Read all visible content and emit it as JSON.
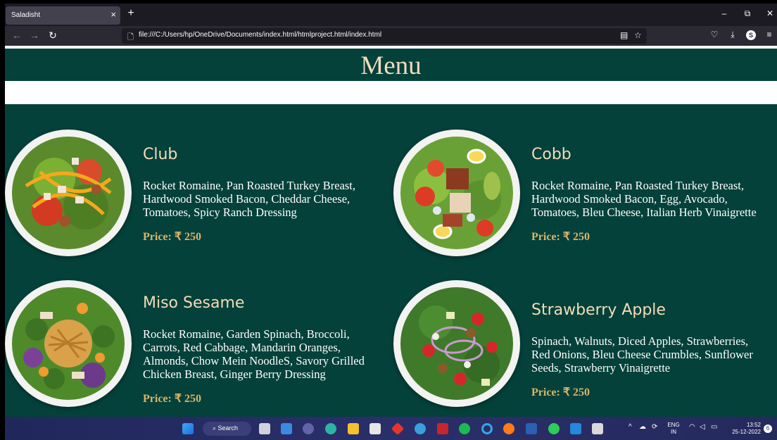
{
  "browser": {
    "tab_title": "Saladisht",
    "tab_close": "×",
    "new_tab": "+",
    "url": "file:///C:/Users/hp/OneDrive/Documents/index.html/htmlproject.html/index.html",
    "window_controls": [
      "–",
      "⧉",
      "✕"
    ],
    "profile_initial": "S"
  },
  "page": {
    "header": "Menu",
    "items": [
      {
        "name": "Club",
        "description": "Rocket Romaine, Pan Roasted Turkey Breast, Hardwood Smoked Bacon, Cheddar Cheese, Tomatoes, Spicy Ranch Dressing",
        "price": "Price: ₹ 250",
        "image": "club-salad-bowl"
      },
      {
        "name": "Cobb",
        "description": "Rocket Romaine, Pan Roasted Turkey Breast, Hardwood Smoked Bacon, Egg, Avocado, Tomatoes, Bleu Cheese, Italian Herb Vinaigrette",
        "price": "Price: ₹ 250",
        "image": "cobb-salad-bowl"
      },
      {
        "name": "Miso Sesame",
        "description": "Rocket Romaine, Garden Spinach, Broccoli, Carrots, Red Cabbage, Mandarin Oranges, Almonds, Chow Mein NoodleS, Savory Grilled Chicken Breast, Ginger Berry Dressing",
        "price": "Price: ₹ 250",
        "image": "miso-sesame-salad-bowl"
      },
      {
        "name": "Strawberry Apple",
        "description": "Spinach, Walnuts, Diced Apples, Strawberries, Red Onions, Bleu Cheese Crumbles, Sunflower Seeds, Strawberry Vinaigrette",
        "price": "Price: ₹ 250",
        "image": "strawberry-apple-salad-bowl"
      }
    ]
  },
  "taskbar": {
    "search_label": "Search",
    "language": "ENG",
    "region": "IN",
    "time": "13:52",
    "date": "25-12-2022",
    "notification_count": "6"
  },
  "colors": {
    "header_bg": "#04413a",
    "title_color": "#f1dcb8",
    "price_color": "#d9b56a"
  }
}
